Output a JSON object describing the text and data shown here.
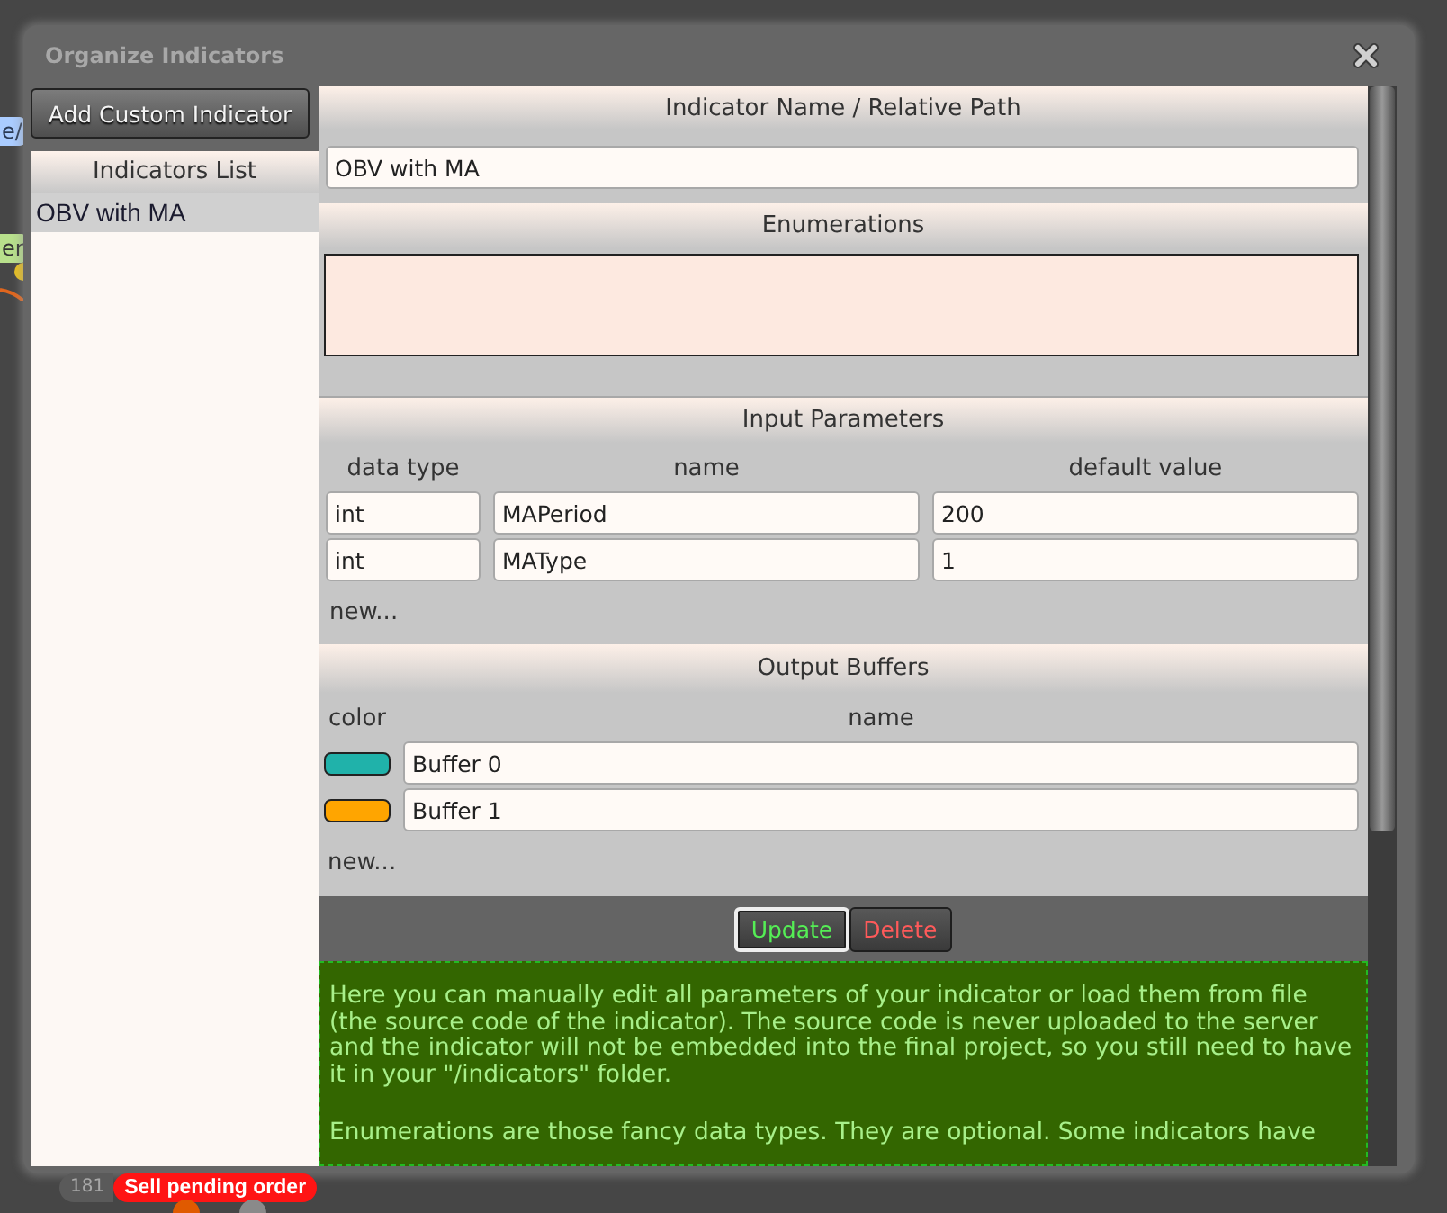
{
  "background_nodes": {
    "labels": [
      {
        "text": "e/",
        "color": "#aaccff"
      },
      {
        "text": "er",
        "color": "#b8e08c"
      }
    ],
    "node": {
      "id": "181",
      "title": "Sell pending order"
    }
  },
  "window": {
    "title": "Organize Indicators"
  },
  "add_button": {
    "label": "Add Custom Indicator"
  },
  "indicators_list": {
    "title": "Indicators List",
    "items": [
      {
        "label": "OBV with MA",
        "selected": true
      }
    ]
  },
  "name_section": {
    "title": "Indicator Name / Relative Path",
    "value": "OBV with MA"
  },
  "enumerations": {
    "title": "Enumerations"
  },
  "input_parameters": {
    "title": "Input Parameters",
    "columns": [
      "data type",
      "name",
      "default value"
    ],
    "rows": [
      {
        "data_type": "int",
        "name": "MAPeriod",
        "default_value": "200"
      },
      {
        "data_type": "int",
        "name": "MAType",
        "default_value": "1"
      }
    ],
    "new_link": "new..."
  },
  "output_buffers": {
    "title": "Output Buffers",
    "columns": [
      "color",
      "name"
    ],
    "rows": [
      {
        "color": "#20b2aa",
        "name": "Buffer 0"
      },
      {
        "color": "#ffa500",
        "name": "Buffer 1"
      }
    ],
    "new_link": "new..."
  },
  "buttons": [
    {
      "label": "Update",
      "kind": "update",
      "focused": true
    },
    {
      "label": "Delete",
      "kind": "delete",
      "focused": false
    }
  ],
  "help": {
    "paragraphs": [
      "Here you can manually edit all parameters of your indicator or load them from file (the source code of the indicator). The source code is never uploaded to the server and the indicator will not be embedded into the final project, so you still need to have it in your \"/indicators\" folder.",
      "Enumerations are those fancy data types. They are optional. Some indicators have"
    ]
  }
}
